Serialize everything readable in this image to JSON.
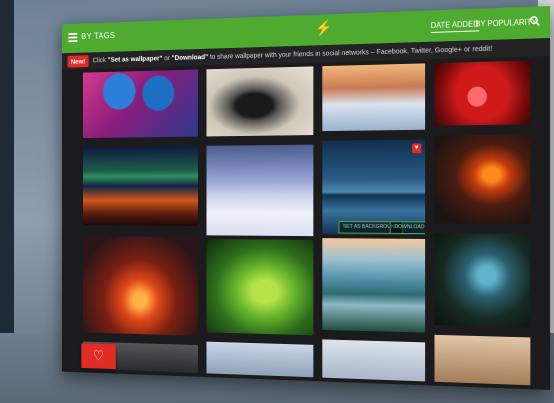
{
  "header": {
    "section_label": "BY TAGS",
    "sort_tabs": [
      {
        "label": "DATE ADDED",
        "active": true
      },
      {
        "label": "BY POPULARITY",
        "active": false
      }
    ],
    "logo_icon": "lightning-bolt-icon",
    "accent_color": "#4eab30"
  },
  "notice": {
    "badge": "New!",
    "text_1": "Click ",
    "set_wallpaper": "\"Set as wallpaper\"",
    "text_2": " or ",
    "download": "\"Download\"",
    "text_3": " to share wallpaper with your friends in social networks – Facebook, Twitter, Google+ or reddit!"
  },
  "grid": {
    "tiles": [
      {
        "subject": "robots"
      },
      {
        "subject": "ink"
      },
      {
        "subject": "snowhill"
      },
      {
        "subject": "rose"
      },
      {
        "subject": "aurora"
      },
      {
        "subject": "snowroad"
      },
      {
        "subject": "bled"
      },
      {
        "subject": "volcano"
      },
      {
        "subject": "lava"
      },
      {
        "subject": "leaf"
      },
      {
        "subject": "valley"
      },
      {
        "subject": "cave"
      }
    ],
    "hover_actions": {
      "set_background": "SET AS BACKGROUND",
      "download": "DOWNLOAD"
    },
    "favorite_icon": "heart-icon"
  },
  "fab": {
    "icon": "heart-icon",
    "color": "#e32b25"
  }
}
